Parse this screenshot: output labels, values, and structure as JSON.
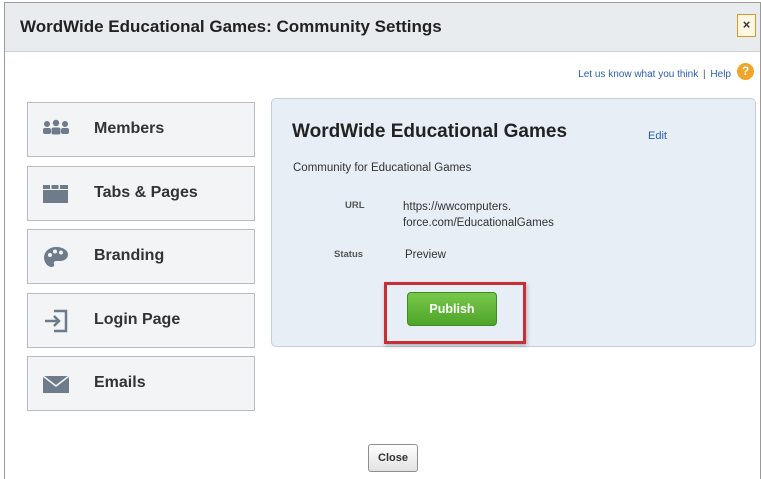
{
  "dialog": {
    "title": "WordWide Educational Games: Community Settings",
    "close_glyph": "×"
  },
  "feedback": {
    "feedback_link": "Let us know what you think",
    "separator": "|",
    "help_link": "Help"
  },
  "nav": [
    {
      "label": "Members",
      "icon": "members-icon"
    },
    {
      "label": "Tabs & Pages",
      "icon": "tabs-icon"
    },
    {
      "label": "Branding",
      "icon": "palette-icon"
    },
    {
      "label": "Login Page",
      "icon": "login-icon"
    },
    {
      "label": "Emails",
      "icon": "envelope-icon"
    }
  ],
  "community": {
    "name": "WordWide Educational Games",
    "edit_label": "Edit",
    "description": "Community for Educational Games",
    "url_label": "URL",
    "url_line1": "https://wwcomputers.",
    "url_line2": "force.com/EducationalGames",
    "status_label": "Status",
    "status_value": "Preview",
    "publish_label": "Publish"
  },
  "footer": {
    "close_label": "Close"
  },
  "colors": {
    "publish_green": "#5cb536",
    "highlight_red": "#c62e38",
    "link_blue": "#2a5db0",
    "help_orange": "#f0a428"
  }
}
